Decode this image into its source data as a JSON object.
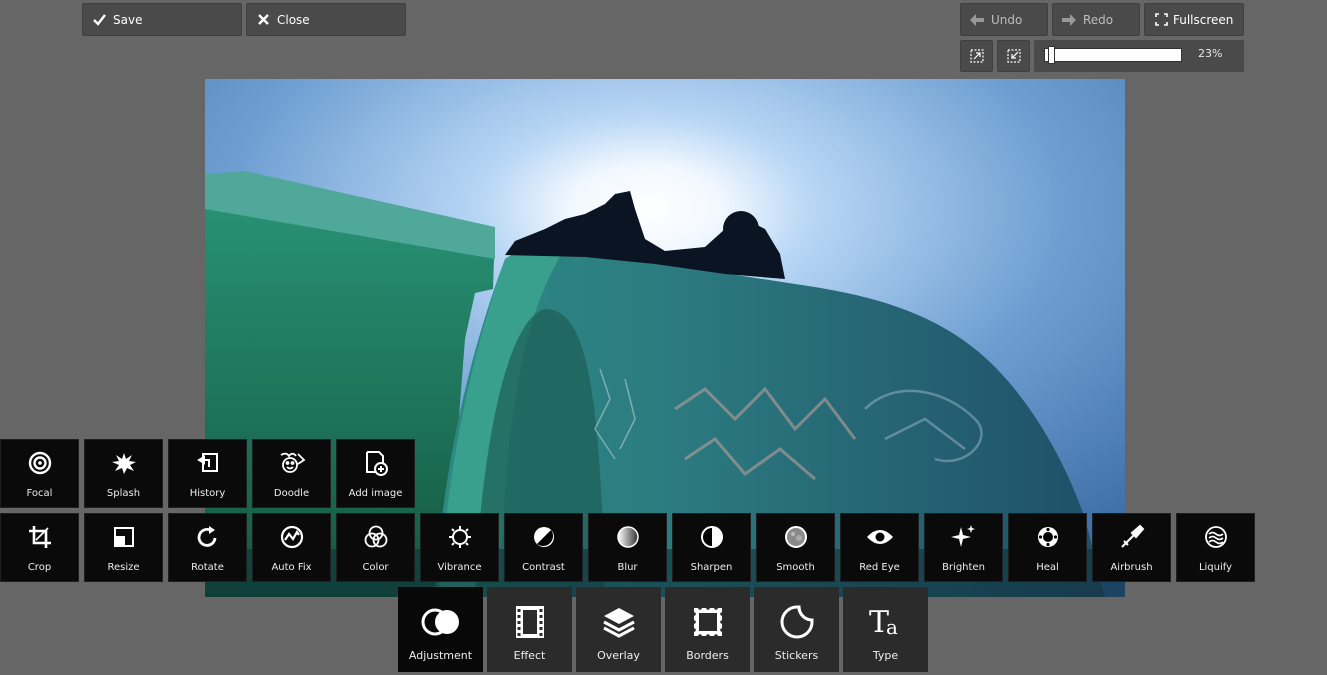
{
  "toolbar": {
    "save_label": "Save",
    "close_label": "Close",
    "undo_label": "Undo",
    "redo_label": "Redo",
    "fullscreen_label": "Fullscreen",
    "zoom_percent": "23%",
    "zoom_level": 0.02
  },
  "tools_row1": [
    {
      "label": "Focal",
      "icon": "focal-icon"
    },
    {
      "label": "Splash",
      "icon": "splash-icon"
    },
    {
      "label": "History",
      "icon": "history-icon"
    },
    {
      "label": "Doodle",
      "icon": "doodle-icon"
    },
    {
      "label": "Add image",
      "icon": "add-image-icon"
    }
  ],
  "tools_row2": [
    {
      "label": "Crop",
      "icon": "crop-icon"
    },
    {
      "label": "Resize",
      "icon": "resize-icon"
    },
    {
      "label": "Rotate",
      "icon": "rotate-icon"
    },
    {
      "label": "Auto Fix",
      "icon": "auto-fix-icon"
    },
    {
      "label": "Color",
      "icon": "color-icon"
    },
    {
      "label": "Vibrance",
      "icon": "vibrance-icon"
    },
    {
      "label": "Contrast",
      "icon": "contrast-icon"
    },
    {
      "label": "Blur",
      "icon": "blur-icon"
    },
    {
      "label": "Sharpen",
      "icon": "sharpen-icon"
    },
    {
      "label": "Smooth",
      "icon": "smooth-icon"
    },
    {
      "label": "Red Eye",
      "icon": "red-eye-icon"
    },
    {
      "label": "Brighten",
      "icon": "brighten-icon"
    },
    {
      "label": "Heal",
      "icon": "heal-icon"
    },
    {
      "label": "Airbrush",
      "icon": "airbrush-icon"
    },
    {
      "label": "Liquify",
      "icon": "liquify-icon"
    }
  ],
  "categories": [
    {
      "label": "Adjustment",
      "icon": "adjustment-icon",
      "active": true
    },
    {
      "label": "Effect",
      "icon": "effect-icon"
    },
    {
      "label": "Overlay",
      "icon": "overlay-icon"
    },
    {
      "label": "Borders",
      "icon": "borders-icon"
    },
    {
      "label": "Stickers",
      "icon": "stickers-icon"
    },
    {
      "label": "Type",
      "icon": "type-icon"
    }
  ],
  "colors": {
    "background": "#666666",
    "button": "#4a4a4a",
    "tool_panel": "#0a0a0a",
    "category": "#2b2b2b"
  }
}
